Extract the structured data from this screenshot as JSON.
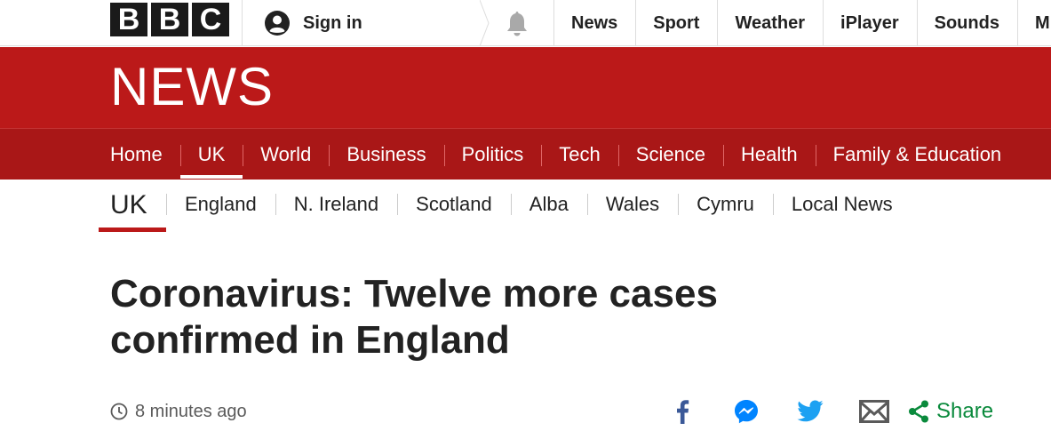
{
  "brand": {
    "logo_letters": [
      "B",
      "B",
      "C"
    ],
    "accent_red": "#bb1919",
    "nav_red": "#a91717",
    "share_green": "#0a8a3c",
    "facebook_blue": "#3b5998",
    "twitter_blue": "#1da1f2",
    "messenger_blue": "#0084ff"
  },
  "topbar": {
    "signin_label": "Sign in",
    "notifications_icon": "bell-icon",
    "nav": [
      "News",
      "Sport",
      "Weather",
      "iPlayer",
      "Sounds",
      "M"
    ]
  },
  "masthead": {
    "title": "NEWS"
  },
  "section_nav": {
    "items": [
      "Home",
      "UK",
      "World",
      "Business",
      "Politics",
      "Tech",
      "Science",
      "Health",
      "Family & Education"
    ],
    "active": "UK"
  },
  "sub_nav": {
    "current": "UK",
    "items": [
      "England",
      "N. Ireland",
      "Scotland",
      "Alba",
      "Wales",
      "Cymru",
      "Local News"
    ]
  },
  "article": {
    "headline": "Coronavirus: Twelve more cases confirmed in England",
    "timestamp": "8 minutes ago"
  },
  "share": {
    "icons": [
      "facebook-icon",
      "messenger-icon",
      "twitter-icon",
      "email-icon",
      "share-icon"
    ],
    "label": "Share"
  }
}
